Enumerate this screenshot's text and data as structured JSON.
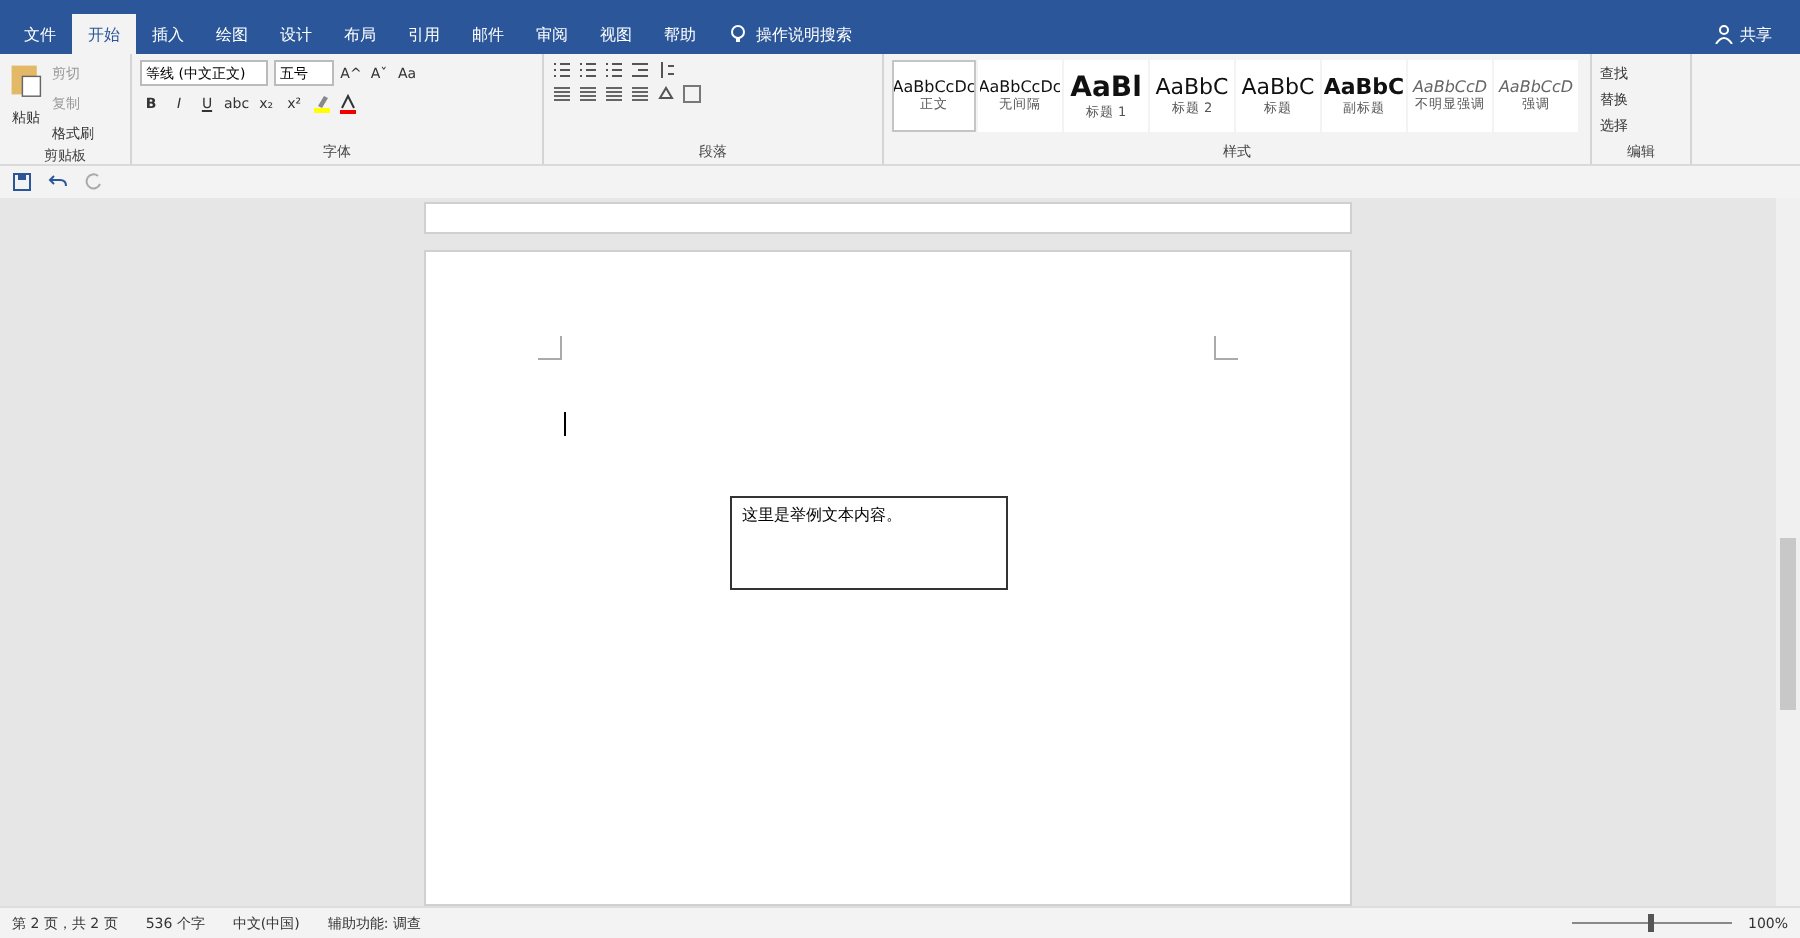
{
  "tabs": [
    {
      "label": "文件",
      "selected": false
    },
    {
      "label": "开始",
      "selected": true
    },
    {
      "label": "插入",
      "selected": false
    },
    {
      "label": "绘图",
      "selected": false
    },
    {
      "label": "设计",
      "selected": false
    },
    {
      "label": "布局",
      "selected": false
    },
    {
      "label": "引用",
      "selected": false
    },
    {
      "label": "邮件",
      "selected": false
    },
    {
      "label": "审阅",
      "selected": false
    },
    {
      "label": "视图",
      "selected": false
    },
    {
      "label": "帮助",
      "selected": false
    }
  ],
  "tell_me": "操作说明搜索",
  "share": "共享",
  "clipboard": {
    "paste": "粘贴",
    "cut": "剪切",
    "copy": "复制",
    "format_painter": "格式刷",
    "label": "剪贴板"
  },
  "font": {
    "name": "等线 (中文正文)",
    "size": "五号",
    "label": "字体",
    "row1": [
      "A^",
      "Aˇ",
      "Aa"
    ],
    "row2": [
      "B",
      "I",
      "U",
      "abc",
      "x₂",
      "x²"
    ]
  },
  "paragraph": {
    "label": "段落"
  },
  "styles": {
    "label": "样式",
    "items": [
      {
        "preview": "AaBbCcDc",
        "name": "正文",
        "selected": true,
        "kind": "normal"
      },
      {
        "preview": "AaBbCcDc",
        "name": "无间隔",
        "selected": false,
        "kind": "normal"
      },
      {
        "preview": "AaBl",
        "name": "标题 1",
        "selected": false,
        "kind": "big"
      },
      {
        "preview": "AaBbC",
        "name": "标题 2",
        "selected": false,
        "kind": "medium"
      },
      {
        "preview": "AaBbC",
        "name": "标题",
        "selected": false,
        "kind": "medium"
      },
      {
        "preview": "AaBbC",
        "name": "副标题",
        "selected": false,
        "kind": "bold"
      },
      {
        "preview": "AaBbCcD",
        "name": "不明显强调",
        "selected": false,
        "kind": "italic"
      },
      {
        "preview": "AaBbCcD",
        "name": "强调",
        "selected": false,
        "kind": "italic"
      }
    ]
  },
  "editing": {
    "label": "编辑",
    "find": "查找",
    "replace": "替换",
    "select": "选择"
  },
  "document": {
    "text_box": "这里是举例文本内容。"
  },
  "status_bar": {
    "page": "第 2 页，共 2 页",
    "words": "536 个字",
    "language": "中文(中国)",
    "accessibility": "辅助功能: 调查",
    "zoom": "100%",
    "zoom_slider": {
      "level": 0.5
    }
  }
}
